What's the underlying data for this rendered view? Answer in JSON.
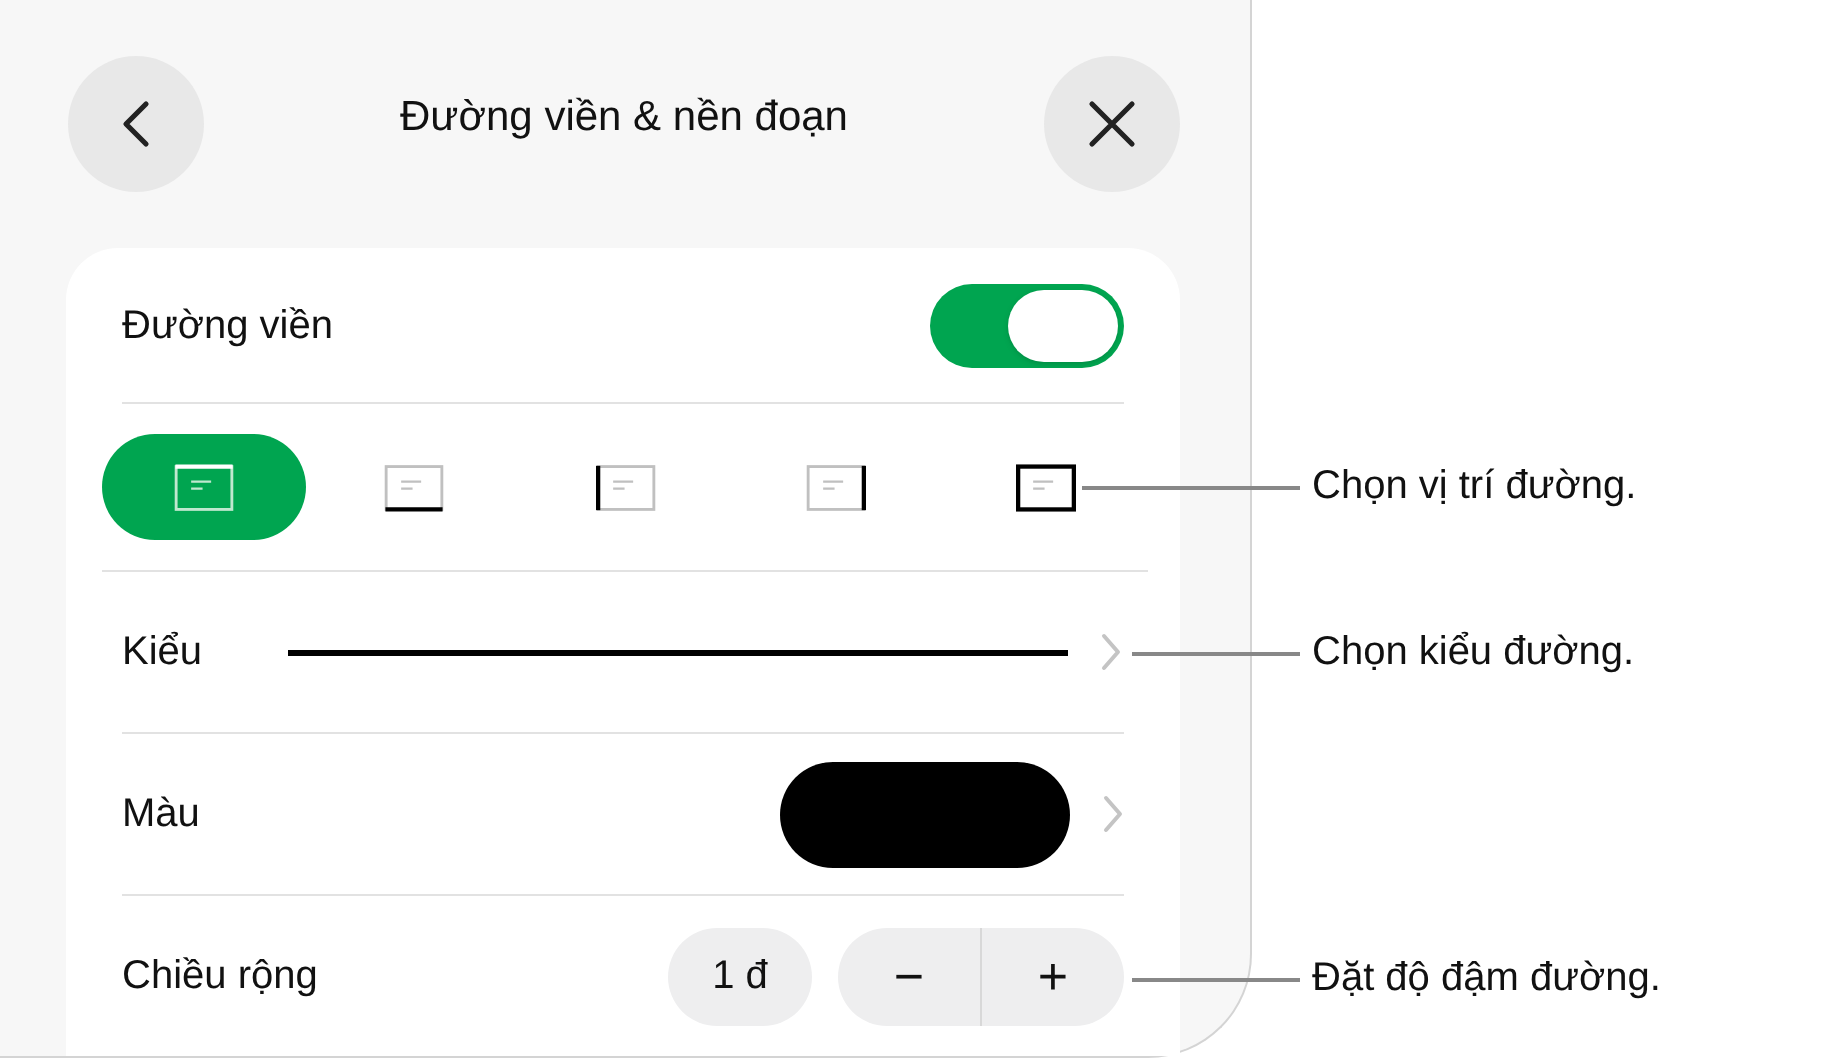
{
  "header": {
    "title": "Đường viền & nền đoạn"
  },
  "borders": {
    "label": "Đường viền",
    "on": true
  },
  "positions": [
    {
      "kind": "top",
      "selected": true
    },
    {
      "kind": "bottom",
      "selected": false
    },
    {
      "kind": "left",
      "selected": false
    },
    {
      "kind": "right",
      "selected": false
    },
    {
      "kind": "all",
      "selected": false
    }
  ],
  "style": {
    "label": "Kiểu"
  },
  "color": {
    "label": "Màu"
  },
  "width": {
    "label": "Chiều rộng",
    "value": "1 đ",
    "decrement": "−",
    "increment": "+"
  },
  "callouts": [
    {
      "text": "Chọn vị trí đường."
    },
    {
      "text": "Chọn kiểu đường."
    },
    {
      "text": "Đặt độ đậm đường."
    }
  ]
}
